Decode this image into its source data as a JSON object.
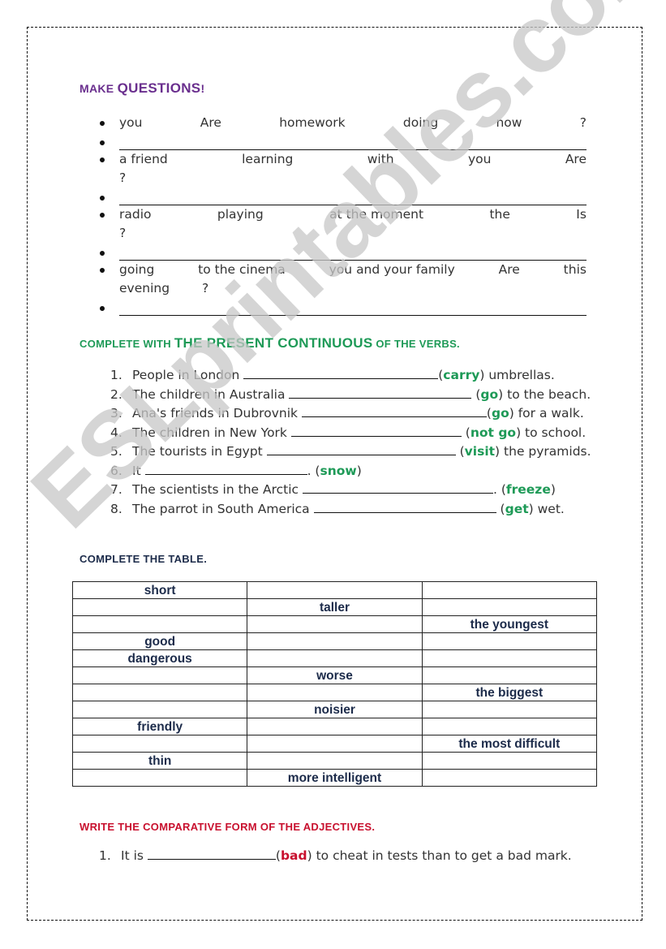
{
  "sections": {
    "make_questions": {
      "title_small": "MAKE ",
      "title_big": "QUESTIONS",
      "title_end": "!",
      "exercises": [
        {
          "words": [
            "you",
            "Are",
            "homework",
            "doing",
            "now",
            "?"
          ],
          "second_line": []
        },
        {
          "words": [
            "a friend",
            "learning",
            "with",
            "you",
            "Are"
          ],
          "second_line": [
            "?"
          ]
        },
        {
          "words": [
            "radio",
            "playing",
            "at the moment",
            "the",
            "Is"
          ],
          "second_line": [
            "?"
          ]
        },
        {
          "words": [
            "going",
            "to the cinema",
            "you and your family",
            "Are",
            "this"
          ],
          "second_line": [
            "evening",
            "?"
          ]
        }
      ]
    },
    "present_continuous": {
      "title_pre": "COMPLETE WITH ",
      "title_big": "THE PRESENT CONTINUOUS",
      "title_post": " OF THE VERBS.",
      "items": [
        {
          "num": "1.",
          "before": "People in London ",
          "verb": "carry",
          "after": " umbrellas."
        },
        {
          "num": "2.",
          "before": "The children in Australia ",
          "verb": "go",
          "after": " to the beach."
        },
        {
          "num": "3.",
          "before": "Ana's friends in Dubrovnik ",
          "verb": "go",
          "after": " for a walk."
        },
        {
          "num": "4.",
          "before": "The children in New York ",
          "verb": "not go",
          "after": " to school."
        },
        {
          "num": "5.",
          "before": "The tourists in Egypt ",
          "verb": "visit",
          "after": " the pyramids."
        },
        {
          "num": "6.",
          "before": "It ",
          "verb": "snow",
          "after": ""
        },
        {
          "num": "7.",
          "before": "The scientists in the Arctic ",
          "verb": "freeze",
          "after": ""
        },
        {
          "num": "8.",
          "before": "The parrot in South America ",
          "verb": "get",
          "after": " wet."
        }
      ]
    },
    "table": {
      "title": "COMPLETE THE TABLE.",
      "rows": [
        [
          "short",
          "",
          ""
        ],
        [
          "",
          "taller",
          ""
        ],
        [
          "",
          "",
          "the youngest"
        ],
        [
          "good",
          "",
          ""
        ],
        [
          "dangerous",
          "",
          ""
        ],
        [
          "",
          "worse",
          ""
        ],
        [
          "",
          "",
          "the biggest"
        ],
        [
          "",
          "noisier",
          ""
        ],
        [
          "friendly",
          "",
          ""
        ],
        [
          "",
          "",
          "the most difficult"
        ],
        [
          "thin",
          "",
          ""
        ],
        [
          "",
          "more intelligent",
          ""
        ]
      ]
    },
    "comparative": {
      "title": "WRITE THE COMPARATIVE FORM OF THE ADJECTIVES.",
      "items": [
        {
          "num": "1.",
          "before": "It is ",
          "verb": "bad",
          "after": " to cheat in tests than to get a bad mark."
        }
      ]
    }
  },
  "watermark": "ESLprintables.com",
  "colors": {
    "purple": "#6a2f8e",
    "green": "#1e9a57",
    "navy": "#1c2b4a",
    "red": "#c8102e"
  }
}
